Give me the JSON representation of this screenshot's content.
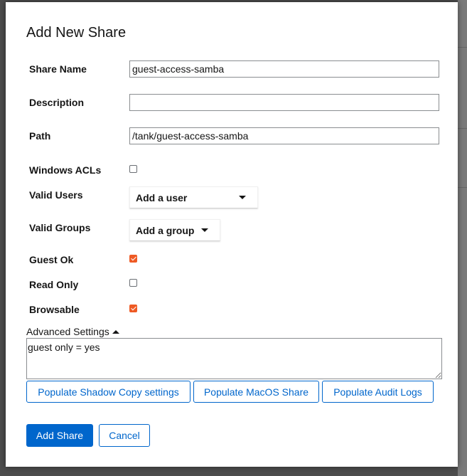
{
  "dialog": {
    "title": "Add New Share",
    "fields": {
      "share_name": {
        "label": "Share Name",
        "value": "guest-access-samba"
      },
      "description": {
        "label": "Description",
        "value": ""
      },
      "path": {
        "label": "Path",
        "value": "/tank/guest-access-samba"
      },
      "windows_acls": {
        "label": "Windows ACLs",
        "checked": false
      },
      "valid_users": {
        "label": "Valid Users",
        "selected": "Add a user"
      },
      "valid_groups": {
        "label": "Valid Groups",
        "selected": "Add a group"
      },
      "guest_ok": {
        "label": "Guest Ok",
        "checked": true
      },
      "read_only": {
        "label": "Read Only",
        "checked": false
      },
      "browsable": {
        "label": "Browsable",
        "checked": true
      }
    },
    "advanced": {
      "label": "Advanced Settings",
      "expanded": true,
      "value": "guest only = yes"
    },
    "populate_buttons": [
      "Populate Shadow Copy settings",
      "Populate MacOS Share",
      "Populate Audit Logs"
    ],
    "submit_label": "Add Share",
    "cancel_label": "Cancel"
  },
  "colors": {
    "primary": "#0066cc",
    "checkbox_checked": "#ee5a24",
    "backdrop": "#4d4d4d"
  }
}
